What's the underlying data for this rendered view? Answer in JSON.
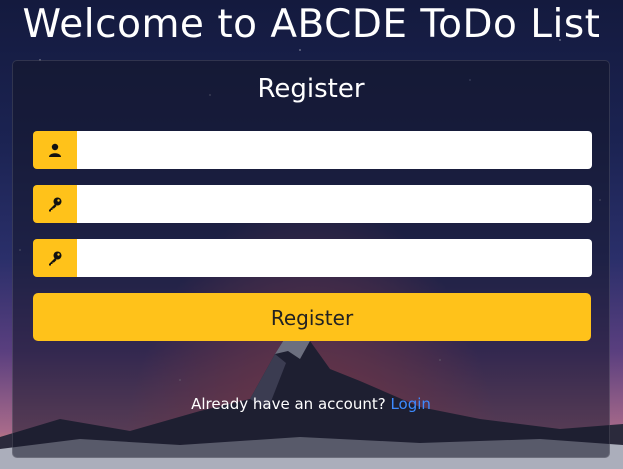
{
  "page": {
    "title": "Welcome to ABCDE ToDo List"
  },
  "register": {
    "heading": "Register",
    "username": {
      "icon": "user-icon",
      "value": "",
      "placeholder": ""
    },
    "password": {
      "icon": "key-icon",
      "value": "",
      "placeholder": ""
    },
    "confirm_password": {
      "icon": "key-icon",
      "value": "",
      "placeholder": ""
    },
    "submit_label": "Register",
    "footer_text": "Already have an account?",
    "login_link": "Login"
  },
  "colors": {
    "accent": "#ffc21a",
    "link": "#3d8bff",
    "card_bg": "rgba(20,22,40,0.55)"
  }
}
